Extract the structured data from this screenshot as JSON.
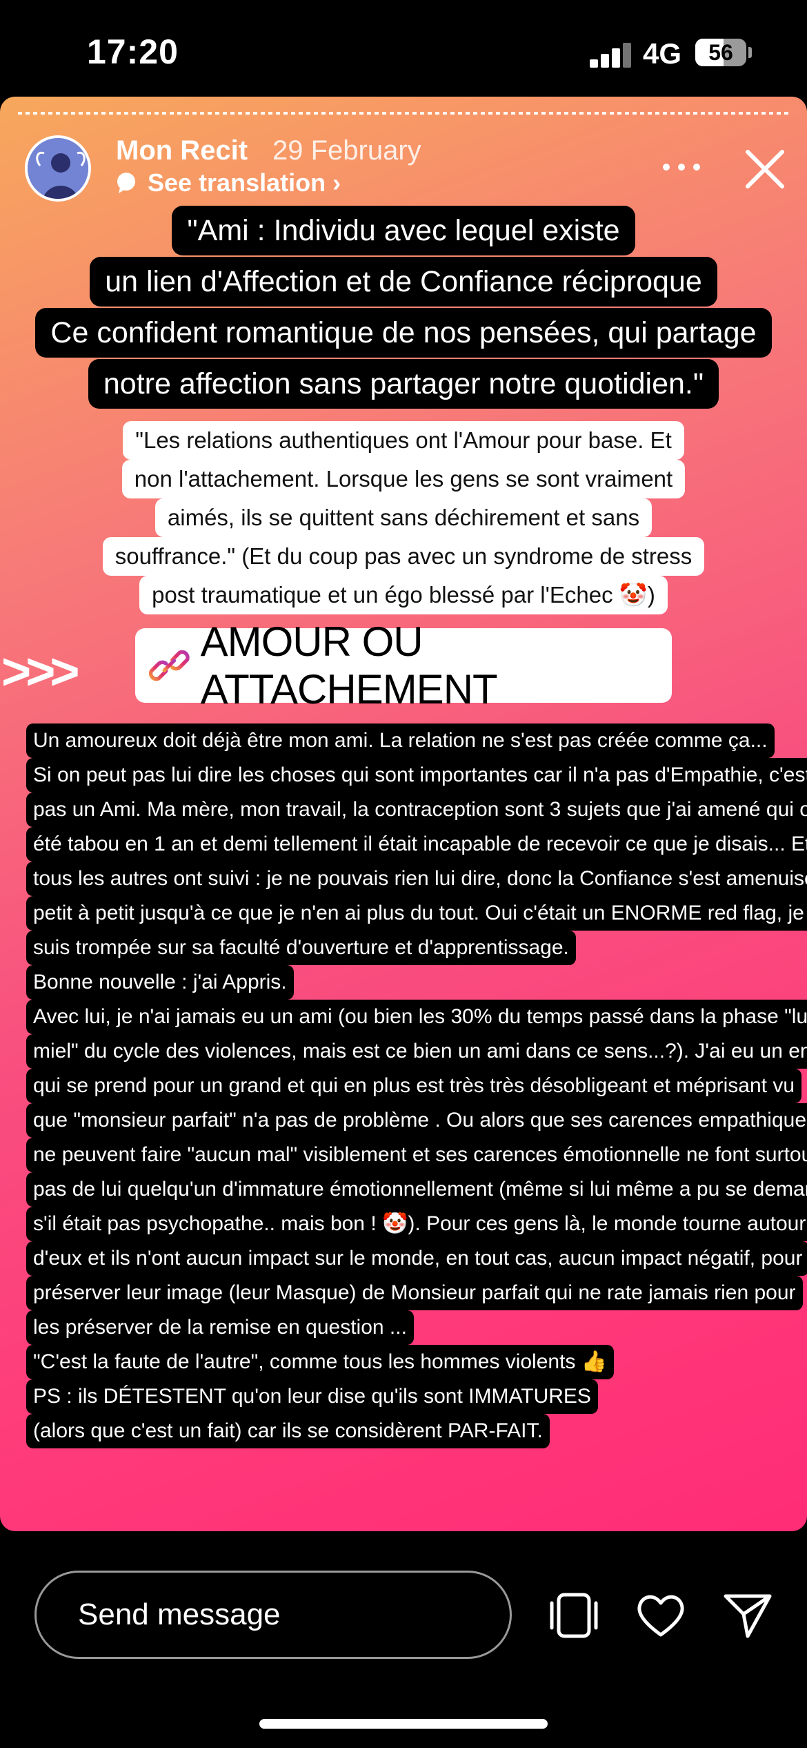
{
  "status_bar": {
    "time": "17:20",
    "network": "4G",
    "battery_percent": "56",
    "battery_level": 0.56
  },
  "story": {
    "username": "Mon Recit",
    "date": "29 February",
    "translate_label": "See translation ›",
    "icons": [
      "avatar",
      "translate-icon",
      "more-icon",
      "close-icon",
      "link-icon",
      "camera-icon",
      "heart-icon",
      "send-icon"
    ],
    "quote_definition": [
      "\"Ami : Individu avec lequel existe",
      "un lien d'Affection et de Confiance réciproque",
      "Ce confident romantique de nos pensées, qui partage",
      "notre affection sans partager notre quotidien.\""
    ],
    "quote_relations": [
      "\"Les relations authentiques ont l'Amour pour base. Et",
      "non l'attachement. Lorsque les gens se sont vraiment",
      "aimés, ils se quittent sans déchirement et sans",
      "souffrance.\" (Et du coup pas avec un syndrome de stress",
      "post traumatique et un égo blessé par l'Echec 🤡)"
    ],
    "arrows": ">>>",
    "link_title": "AMOUR OU ATTACHEMENT",
    "body_lines": [
      "Un amoureux doit déjà être mon ami. La relation ne s'est pas créée comme ça...",
      "Si on peut pas lui dire les choses qui sont importantes car il n'a pas d'Empathie, c'est",
      "pas un Ami. Ma mère, mon travail, la contraception sont 3 sujets que j'ai amené qui ont",
      "été tabou en 1 an et demi tellement il était incapable de recevoir ce que je disais... Et",
      "tous les autres ont suivi : je ne pouvais rien lui dire, donc la Confiance s'est amenuisée",
      "petit à petit jusqu'à ce que je n'en ai plus du tout. Oui c'était un ENORME red flag, je me",
      "suis trompée sur sa faculté d'ouverture et d'apprentissage.",
      "Bonne nouvelle : j'ai Appris.",
      "Avec lui, je n'ai jamais eu un ami (ou bien les 30% du temps passé dans la phase \"lune de",
      "miel\" du cycle des violences, mais est ce bien un ami dans ce sens...?). J'ai eu un enfant",
      "qui se prend pour un grand et qui en plus est très très désobligeant et méprisant vu",
      "que \"monsieur parfait\" n'a pas de problème . Ou alors que ses carences empathiques",
      "ne peuvent faire \"aucun mal\" visiblement et ses carences émotionnelle ne font surtout",
      "pas de lui quelqu'un d'immature émotionnellement (même si lui même a pu se demander",
      "s'il était pas psychopathe.. mais bon ! 🤡). Pour ces gens là, le monde tourne autour",
      "d'eux et ils n'ont aucun impact sur le monde, en tout cas, aucun impact négatif, pour",
      "préserver leur image (leur Masque) de Monsieur parfait qui ne rate jamais rien pour",
      "les préserver de la remise en question ...",
      "\"C'est la faute de l'autre\", comme tous les hommes violents 👍",
      "PS : ils DÉTESTENT qu'on leur dise qu'ils sont IMMATURES",
      "(alors que c'est un fait) car ils se considèrent PAR-FAIT."
    ]
  },
  "bottom_bar": {
    "message_placeholder": "Send message"
  }
}
